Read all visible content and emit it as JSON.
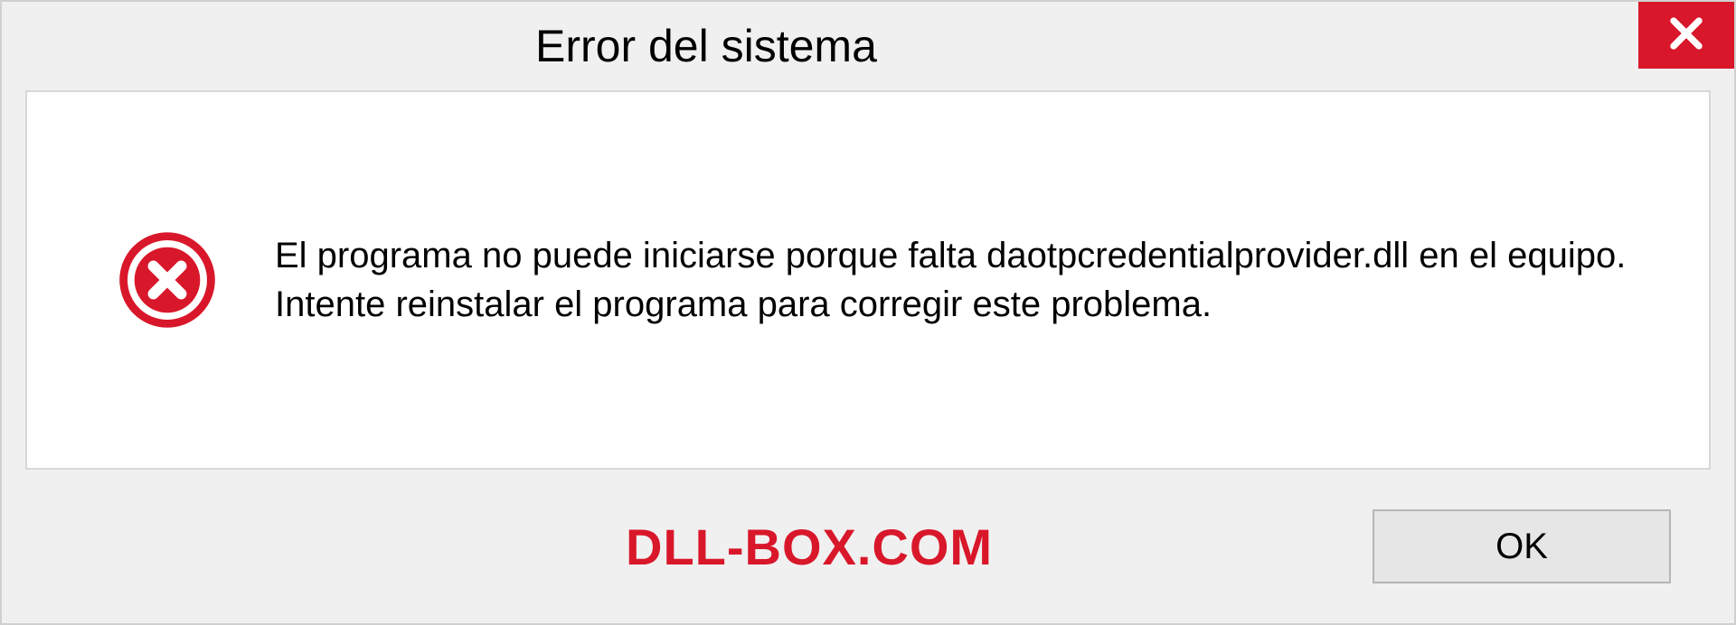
{
  "dialog": {
    "title": "Error del sistema",
    "message": "El programa no puede iniciarse porque falta daotpcredentialprovider.dll en el equipo. Intente reinstalar el programa para corregir este problema.",
    "ok_label": "OK"
  },
  "watermark": "DLL-BOX.COM"
}
